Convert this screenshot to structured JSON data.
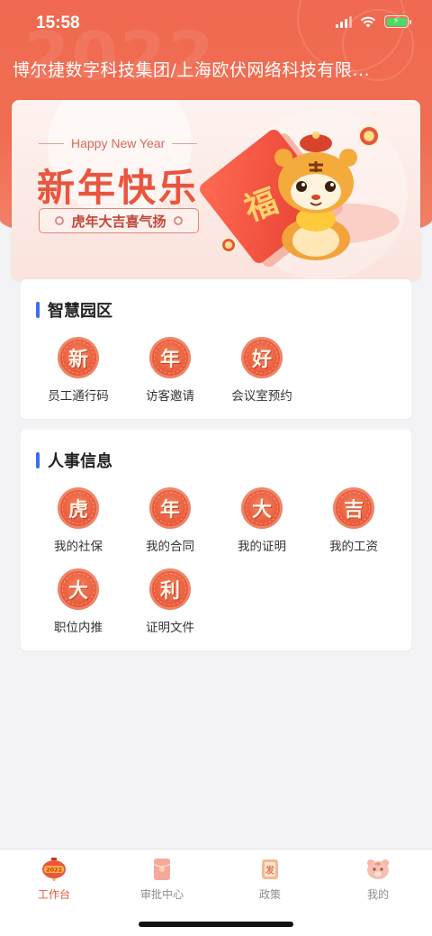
{
  "status_bar": {
    "time": "15:58"
  },
  "header": {
    "company": "博尔捷数字科技集团/上海欧伏网络科技有限..."
  },
  "banner": {
    "en_title": "Happy New Year",
    "cn_title": "新年快乐",
    "subtitle": "虎年大吉喜气扬",
    "fu_char": "福",
    "watermark": "2022"
  },
  "smart_park": {
    "title": "智慧园区",
    "items": [
      {
        "glyph": "新",
        "label": "员工通行码"
      },
      {
        "glyph": "年",
        "label": "访客邀请"
      },
      {
        "glyph": "好",
        "label": "会议室预约"
      }
    ]
  },
  "hr_info": {
    "title": "人事信息",
    "items": [
      {
        "glyph": "虎",
        "label": "我的社保"
      },
      {
        "glyph": "年",
        "label": "我的合同"
      },
      {
        "glyph": "大",
        "label": "我的证明"
      },
      {
        "glyph": "吉",
        "label": "我的工资"
      },
      {
        "glyph": "大",
        "label": "职位内推"
      },
      {
        "glyph": "利",
        "label": "证明文件"
      }
    ]
  },
  "tabbar": {
    "items": [
      {
        "label": "工作台",
        "icon": "lantern-2022-icon",
        "active": true
      },
      {
        "label": "审批中心",
        "icon": "red-envelope-icon",
        "active": false
      },
      {
        "label": "政策",
        "icon": "fa-card-icon",
        "active": false
      },
      {
        "label": "我的",
        "icon": "tiger-face-icon",
        "active": false
      }
    ]
  },
  "colors": {
    "accent": "#e9553e",
    "header_bg": "#ef6a50",
    "section_bar": "#3b6ef0"
  }
}
